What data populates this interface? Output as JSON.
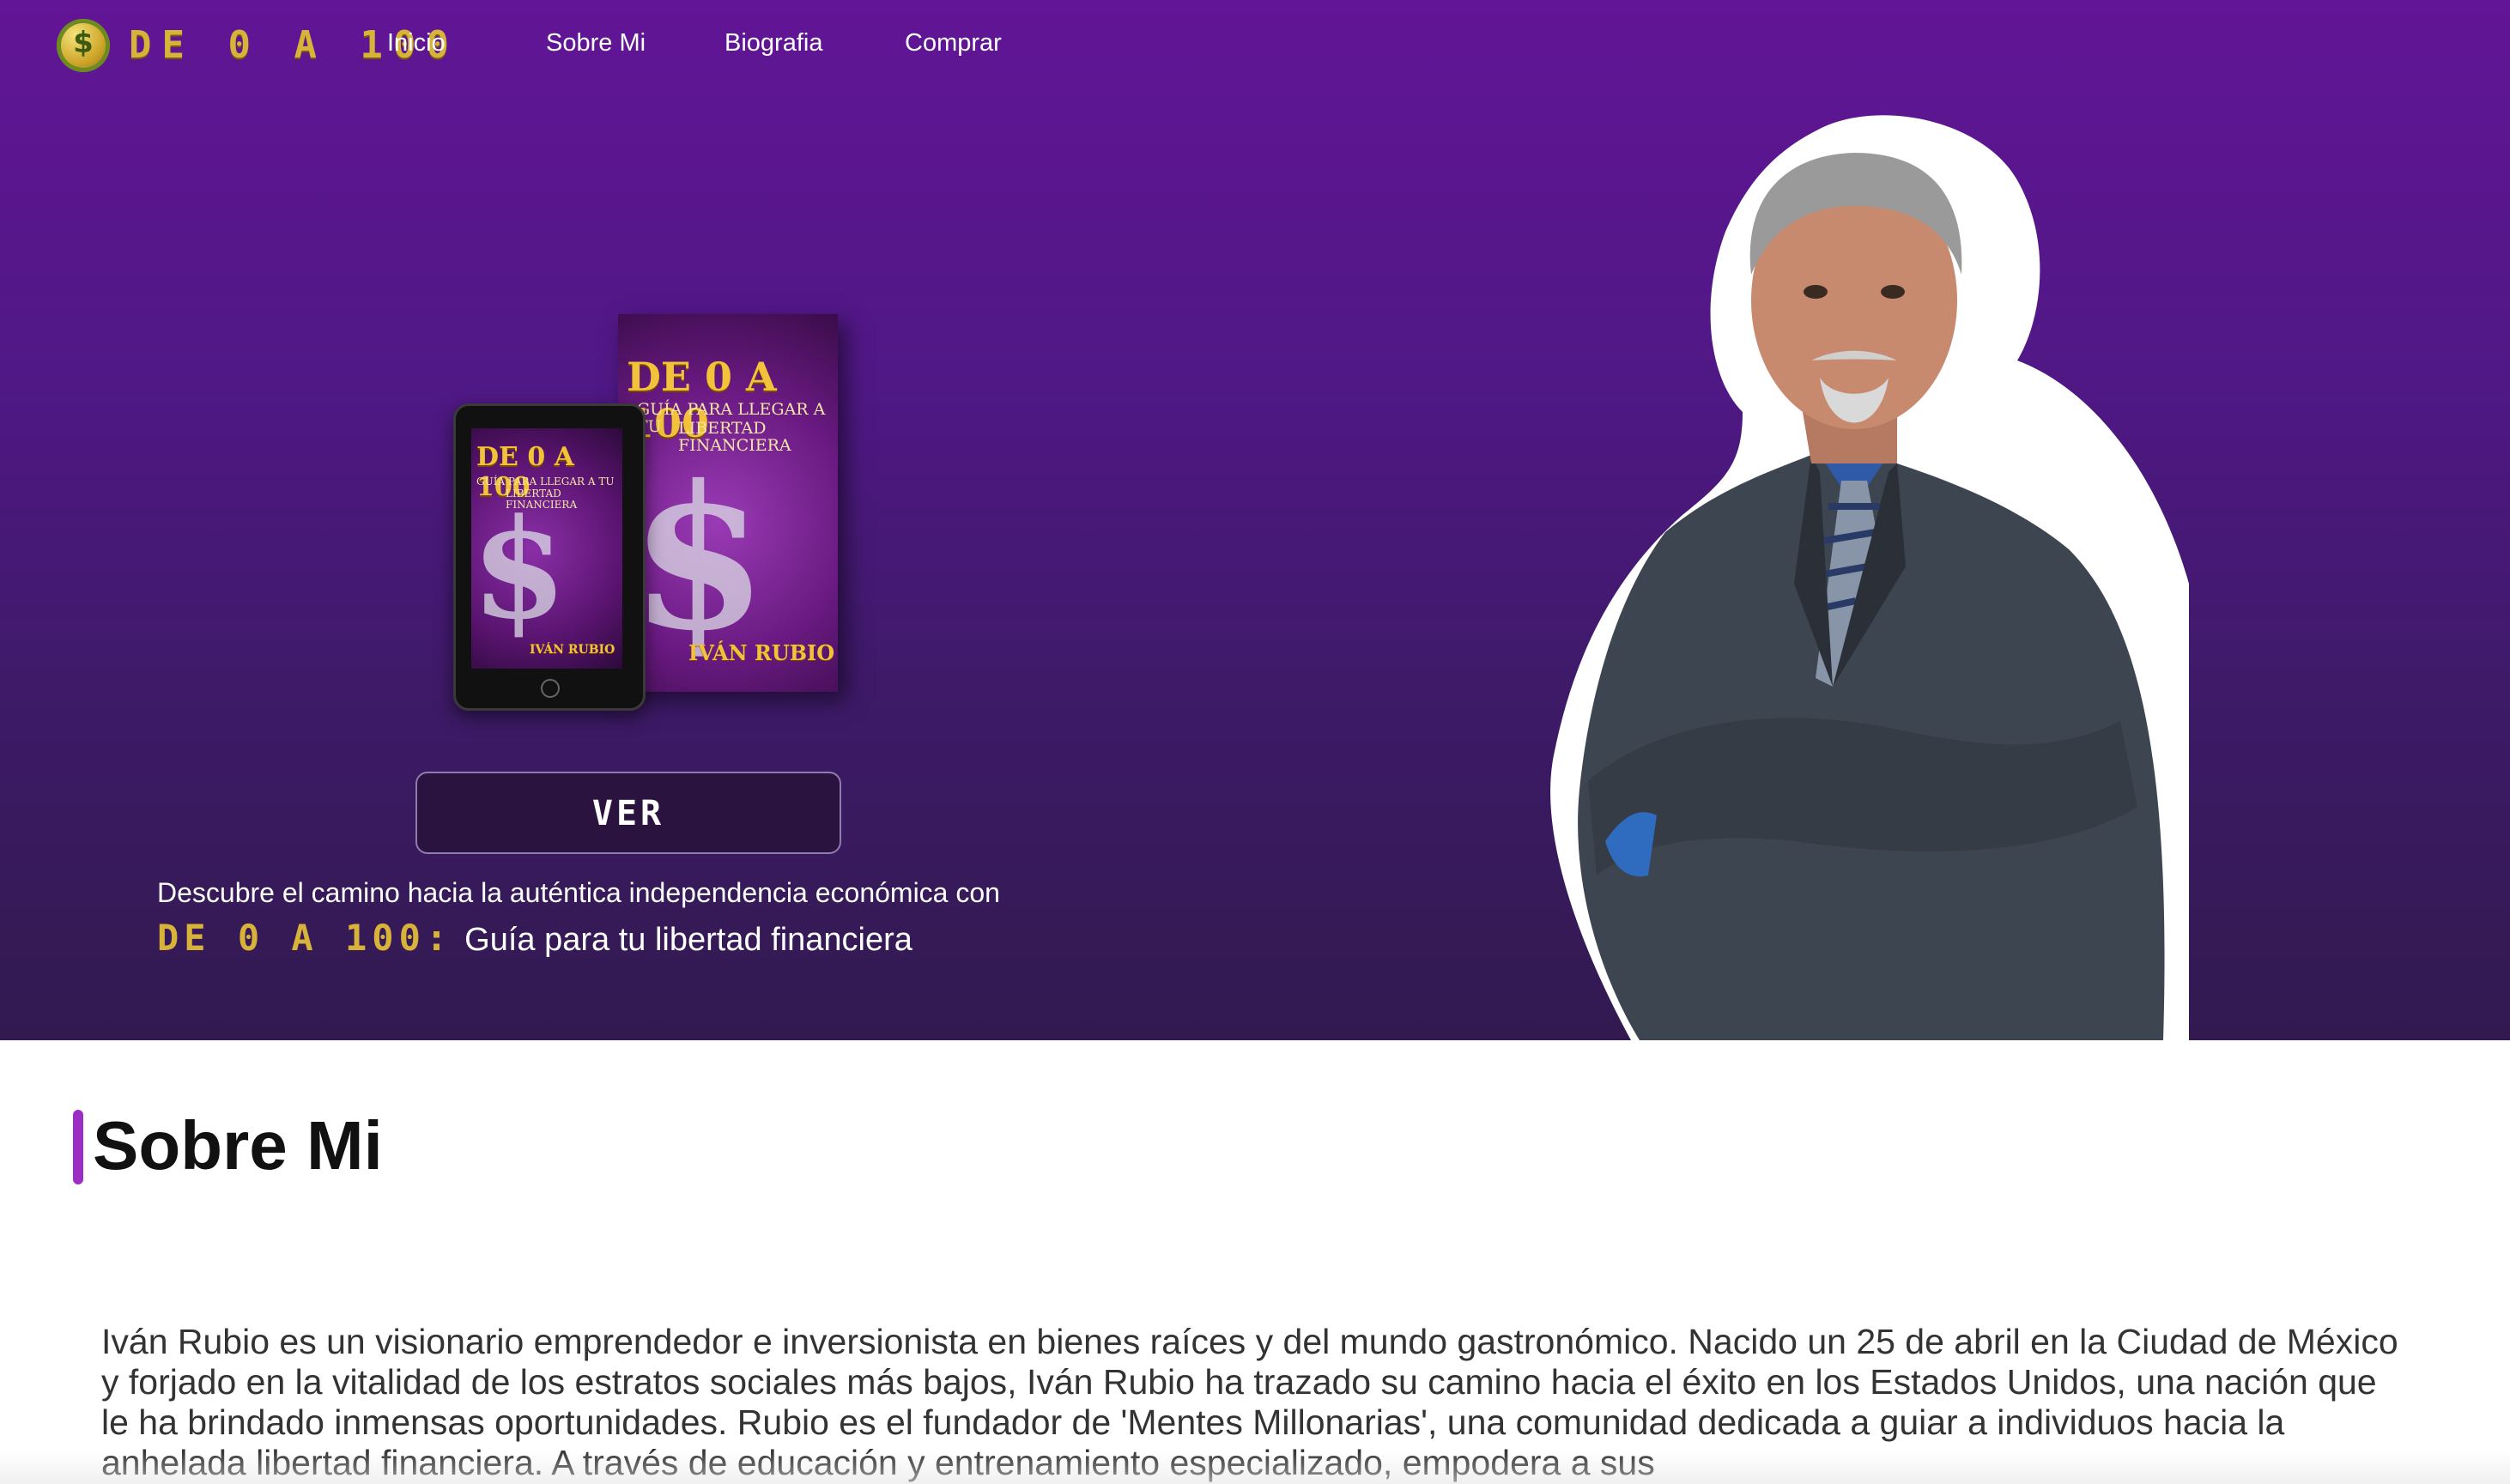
{
  "nav": {
    "logo_text": "DE 0 A 100",
    "logo_icon": "dollar-coin-icon",
    "links": [
      "Inicio",
      "Sobre Mi",
      "Biografia",
      "Comprar"
    ]
  },
  "hero": {
    "book_cover": {
      "title": "DE 0 A 100",
      "subtitle_line1": "GUÍA PARA LLEGAR A TU",
      "subtitle_line2": "LIBERTAD FINANCIERA",
      "author": "IVÁN RUBIO",
      "symbol": "$"
    },
    "ver_button": "VER",
    "tagline": "Descubre el camino hacia la auténtica independencia económica con",
    "book_title": "DE 0 A 100:",
    "book_subtitle": "Guía para tu libertad financiera"
  },
  "about": {
    "title": "Sobre Mi",
    "body": "Iván Rubio es un visionario emprendedor e inversionista en bienes raíces y del mundo gastronómico. Nacido un 25 de abril en la Ciudad de México y forjado en la vitalidad de los estratos sociales más bajos, Iván Rubio ha trazado su camino hacia el éxito en los Estados Unidos, una nación que le ha brindado inmensas oportunidades. Rubio es el fundador de 'Mentes Millonarias', una comunidad dedicada a guiar a individuos hacia la anhelada libertad financiera. A través de educación y entrenamiento especializado, empodera a sus"
  },
  "colors": {
    "hero_top": "#621596",
    "hero_bottom": "#321a50",
    "gold": "#d8b33a",
    "accent_bar": "#9b2fc4",
    "button_bg": "#2b1340"
  }
}
